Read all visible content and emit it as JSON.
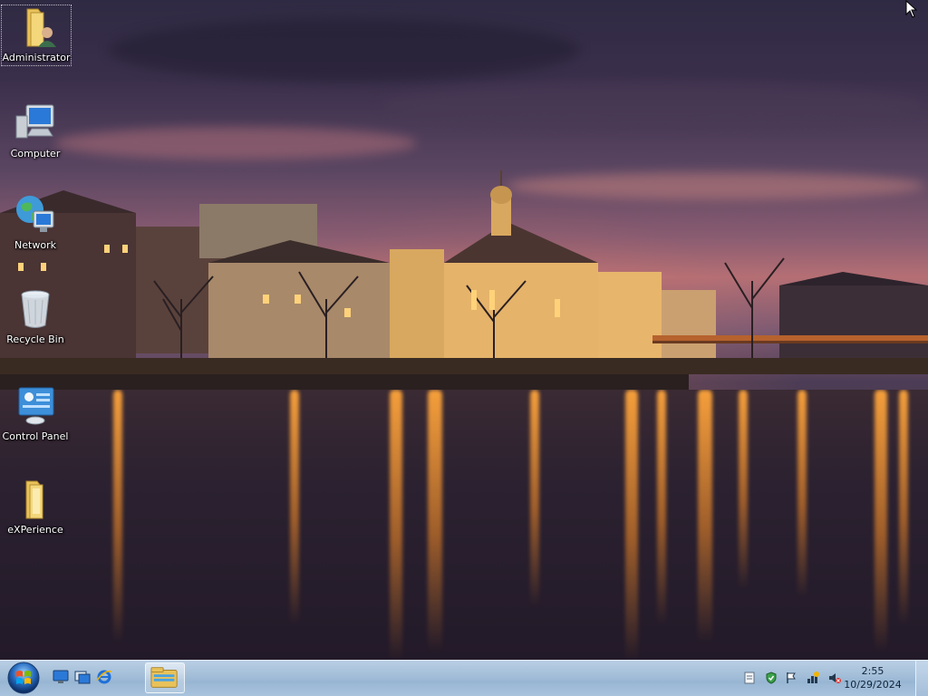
{
  "desktop": {
    "icons": [
      {
        "label": "Administrator",
        "icon": "user-folder-icon"
      },
      {
        "label": "Computer",
        "icon": "computer-icon"
      },
      {
        "label": "Network",
        "icon": "network-icon"
      },
      {
        "label": "Recycle Bin",
        "icon": "recycle-bin-icon"
      },
      {
        "label": "Control Panel",
        "icon": "control-panel-icon"
      },
      {
        "label": "eXPerience",
        "icon": "folder-icon"
      }
    ]
  },
  "taskbar": {
    "start_icon": "windows-start-orb-icon",
    "quick_launch": [
      {
        "icon": "show-desktop-icon"
      },
      {
        "icon": "switch-windows-icon"
      },
      {
        "icon": "internet-explorer-icon"
      }
    ],
    "pinned": [
      {
        "icon": "windows-explorer-icon"
      }
    ],
    "tray": {
      "icons": [
        {
          "icon": "notes-icon"
        },
        {
          "icon": "security-shield-icon"
        },
        {
          "icon": "action-center-flag-icon"
        },
        {
          "icon": "network-status-icon"
        },
        {
          "icon": "volume-muted-icon"
        }
      ],
      "time": "2:55",
      "date": "10/29/2024"
    }
  },
  "colors": {
    "taskbar": "#a4bfd9",
    "sky_top": "#2f2a43",
    "sky_glow": "#b56f74",
    "light_reflection": "#ffa53c"
  }
}
